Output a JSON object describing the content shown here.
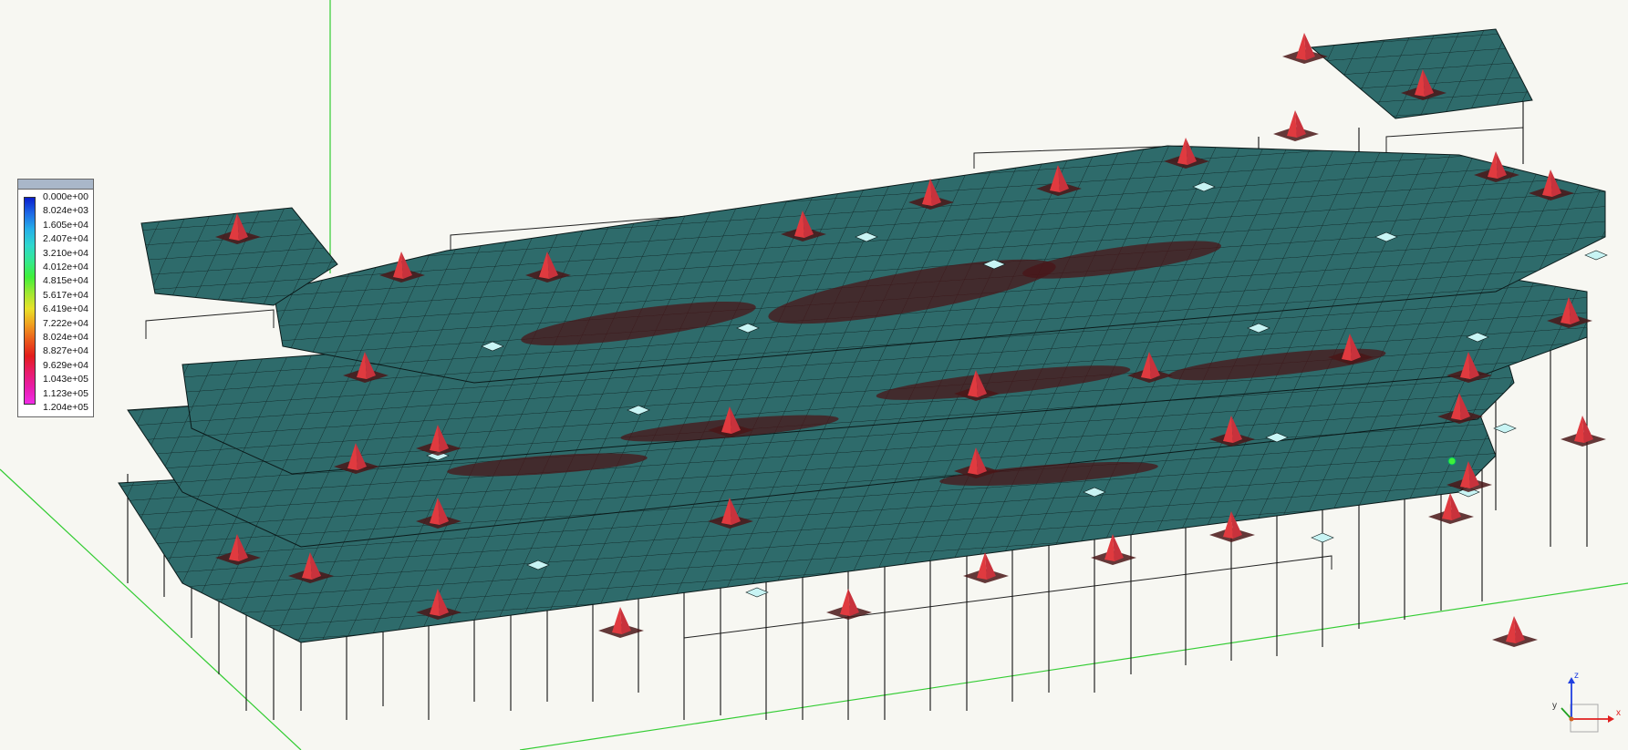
{
  "legend": {
    "colors": [
      "#0a1ecc",
      "#1e6ae6",
      "#26b0e8",
      "#2fd7ce",
      "#35e890",
      "#3ff03a",
      "#9ee833",
      "#e8e22a",
      "#f0a020",
      "#ea5a1c",
      "#e21c1c",
      "#e81c6a",
      "#e81cac",
      "#f02ce6"
    ],
    "labels": [
      "0.000e+00",
      "8.024e+03",
      "1.605e+04",
      "2.407e+04",
      "3.210e+04",
      "4.012e+04",
      "4.815e+04",
      "5.617e+04",
      "6.419e+04",
      "7.222e+04",
      "8.024e+04",
      "8.827e+04",
      "9.629e+04",
      "1.043e+05",
      "1.123e+05",
      "1.204e+05"
    ]
  },
  "axes": {
    "x_label": "x",
    "y_label": "y",
    "z_label": "z",
    "x_color": "#e02020",
    "y_color": "#20a020",
    "z_color": "#2040e0"
  },
  "model": {
    "slab_color": "#2e6b6b",
    "mesh_color": "#0b1a1a",
    "peak_color": "#c8323c",
    "hot_color": "#4a1618",
    "light_color": "#c8f4f4",
    "column_color": "#111111",
    "grid_line_color": "#33cc33"
  }
}
